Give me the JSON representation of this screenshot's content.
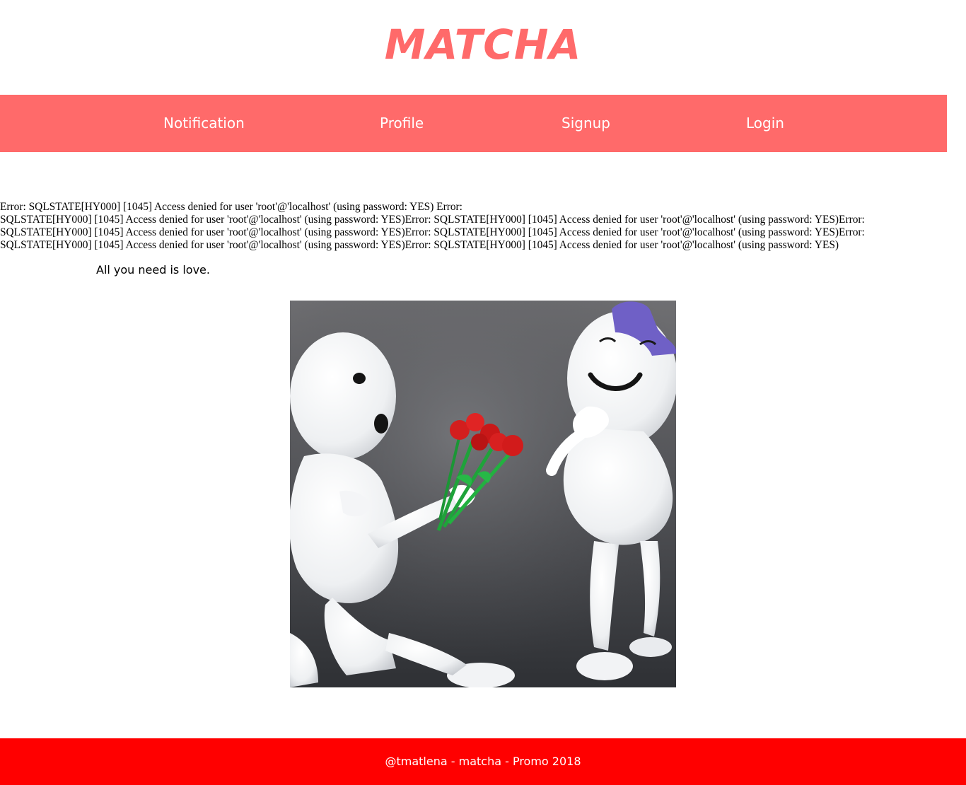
{
  "header": {
    "title": "MATCHA"
  },
  "nav": {
    "items": [
      {
        "label": "Notification"
      },
      {
        "label": "Profile"
      },
      {
        "label": "Signup"
      },
      {
        "label": "Login"
      }
    ]
  },
  "main": {
    "error_lines": [
      "Error: SQLSTATE[HY000] [1045] Access denied for user 'root'@'localhost' (using password: YES) Error:",
      "SQLSTATE[HY000] [1045] Access denied for user 'root'@'localhost' (using password: YES)Error: SQLSTATE[HY000] [1045] Access denied for user 'root'@'localhost' (using password: YES)Error:",
      "SQLSTATE[HY000] [1045] Access denied for user 'root'@'localhost' (using password: YES)Error: SQLSTATE[HY000] [1045] Access denied for user 'root'@'localhost' (using password: YES)Error:",
      "SQLSTATE[HY000] [1045] Access denied for user 'root'@'localhost' (using password: YES)Error: SQLSTATE[HY000] [1045] Access denied for user 'root'@'localhost' (using password: YES)"
    ],
    "tagline": "All you need is love."
  },
  "footer": {
    "text": "@tmatlena - matcha - Promo 2018"
  },
  "colors": {
    "brand": "#ff6a6a",
    "footer": "#ff0000"
  }
}
